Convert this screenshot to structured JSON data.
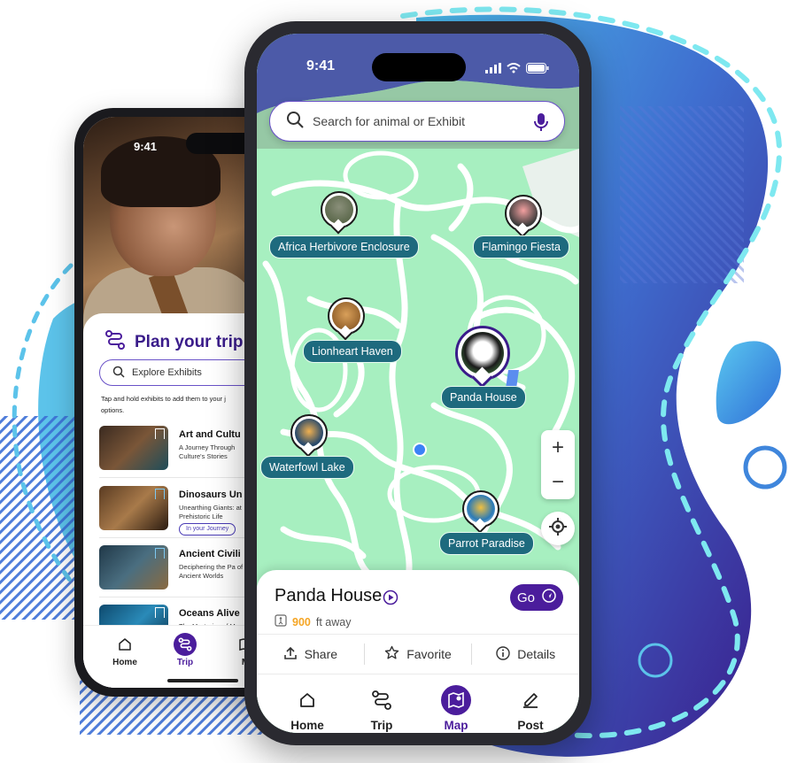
{
  "colors": {
    "brand_purple": "#4b1d9c",
    "map_green": "#a7efc0",
    "label_teal": "#1e6a7e",
    "distance_orange": "#f5a524"
  },
  "back_phone": {
    "status_time": "9:41",
    "plan_title": "Plan your trip",
    "explore_placeholder": "Explore Exhibits",
    "hint": "Tap and hold exhibits to add them to your j... options.",
    "hint_line1": "Tap and hold exhibits to add them to your j",
    "hint_line2": "options.",
    "exhibits": [
      {
        "name": "Art and Cultu",
        "desc": "A Journey Through Culture's Stories",
        "badge": ""
      },
      {
        "name": "Dinosaurs Un",
        "desc": "Unearthing Giants: at Prehistoric Life",
        "badge": "In your Journey"
      },
      {
        "name": "Ancient Civili",
        "desc": "Deciphering the Pa of Ancient Worlds",
        "badge": ""
      },
      {
        "name": "Oceans Alive",
        "desc": "The Mysteries of M",
        "badge": ""
      }
    ],
    "nav": [
      {
        "label": "Home",
        "icon": "home-icon"
      },
      {
        "label": "Trip",
        "icon": "route-icon"
      },
      {
        "label": "M",
        "icon": "map-icon"
      }
    ]
  },
  "front_phone": {
    "status_time": "9:41",
    "search_placeholder": "Search for animal or Exhibit",
    "map_labels": {
      "africa": "Africa Herbivore Enclosure",
      "flamingo": "Flamingo Fiesta",
      "lion": "Lionheart Haven",
      "panda": "Panda House",
      "waterfowl": "Waterfowl Lake",
      "parrot": "Parrot Paradise"
    },
    "zoom_in": "+",
    "zoom_out": "−",
    "sheet": {
      "title": "Panda House",
      "go_label": "Go",
      "distance_value": "900",
      "distance_unit": "ft away",
      "share": "Share",
      "favorite": "Favorite",
      "details": "Details"
    },
    "nav": [
      {
        "label": "Home",
        "icon": "home-icon"
      },
      {
        "label": "Trip",
        "icon": "route-icon"
      },
      {
        "label": "Map",
        "icon": "map-icon"
      },
      {
        "label": "Post",
        "icon": "edit-icon"
      }
    ]
  }
}
